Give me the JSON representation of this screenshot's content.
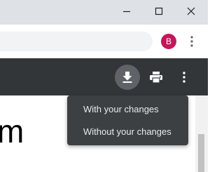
{
  "window_controls": {
    "minimize_icon": "minimize-icon",
    "maximize_icon": "maximize-icon",
    "close_icon": "close-icon"
  },
  "toolbar": {
    "omnibox_value": "",
    "avatar_initial": "B",
    "avatar_color": "#c2185b",
    "menu_icon": "vertical-dots-icon"
  },
  "pdf_toolbar": {
    "background_color": "#323639",
    "download_icon": "download-icon",
    "print_icon": "print-icon",
    "more_icon": "vertical-dots-icon"
  },
  "download_menu": {
    "items": [
      {
        "label": "With your changes"
      },
      {
        "label": "Without your changes"
      }
    ]
  },
  "document": {
    "visible_text": "m"
  }
}
